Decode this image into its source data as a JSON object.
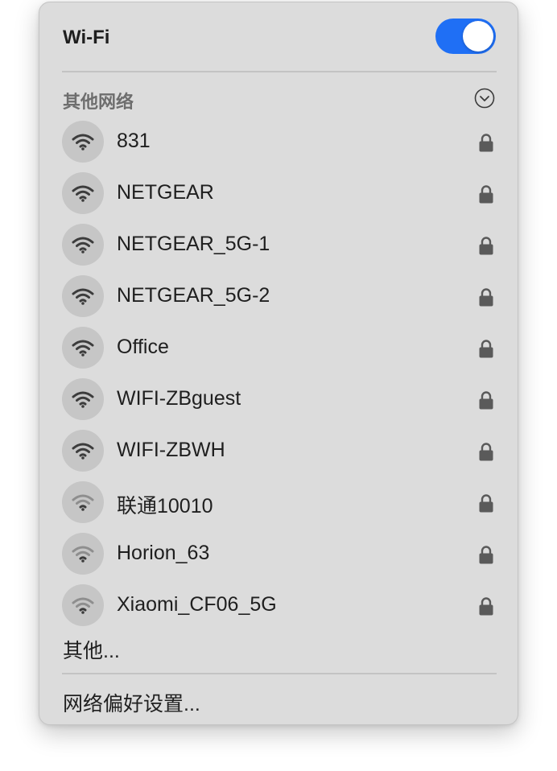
{
  "header": {
    "title": "Wi-Fi",
    "toggle_on": true
  },
  "colors": {
    "toggle_on": "#1f6ff5",
    "panel_bg": "#dcdcdc"
  },
  "other_networks": {
    "label": "其他网络",
    "expand_icon": "chevron-down-circle-icon"
  },
  "networks": [
    {
      "name": "831",
      "signal": "strong",
      "secured": true
    },
    {
      "name": "NETGEAR",
      "signal": "strong",
      "secured": true
    },
    {
      "name": "NETGEAR_5G-1",
      "signal": "strong",
      "secured": true
    },
    {
      "name": "NETGEAR_5G-2",
      "signal": "strong",
      "secured": true
    },
    {
      "name": "Office",
      "signal": "strong",
      "secured": true
    },
    {
      "name": "WIFI-ZBguest",
      "signal": "strong",
      "secured": true
    },
    {
      "name": "WIFI-ZBWH",
      "signal": "strong",
      "secured": true
    },
    {
      "name": "联通10010",
      "signal": "weak",
      "secured": true
    },
    {
      "name": "Horion_63",
      "signal": "weak",
      "secured": true
    },
    {
      "name": "Xiaomi_CF06_5G",
      "signal": "weak",
      "secured": true
    }
  ],
  "footer": {
    "other_label": "其他...",
    "preferences_label": "网络偏好设置..."
  }
}
